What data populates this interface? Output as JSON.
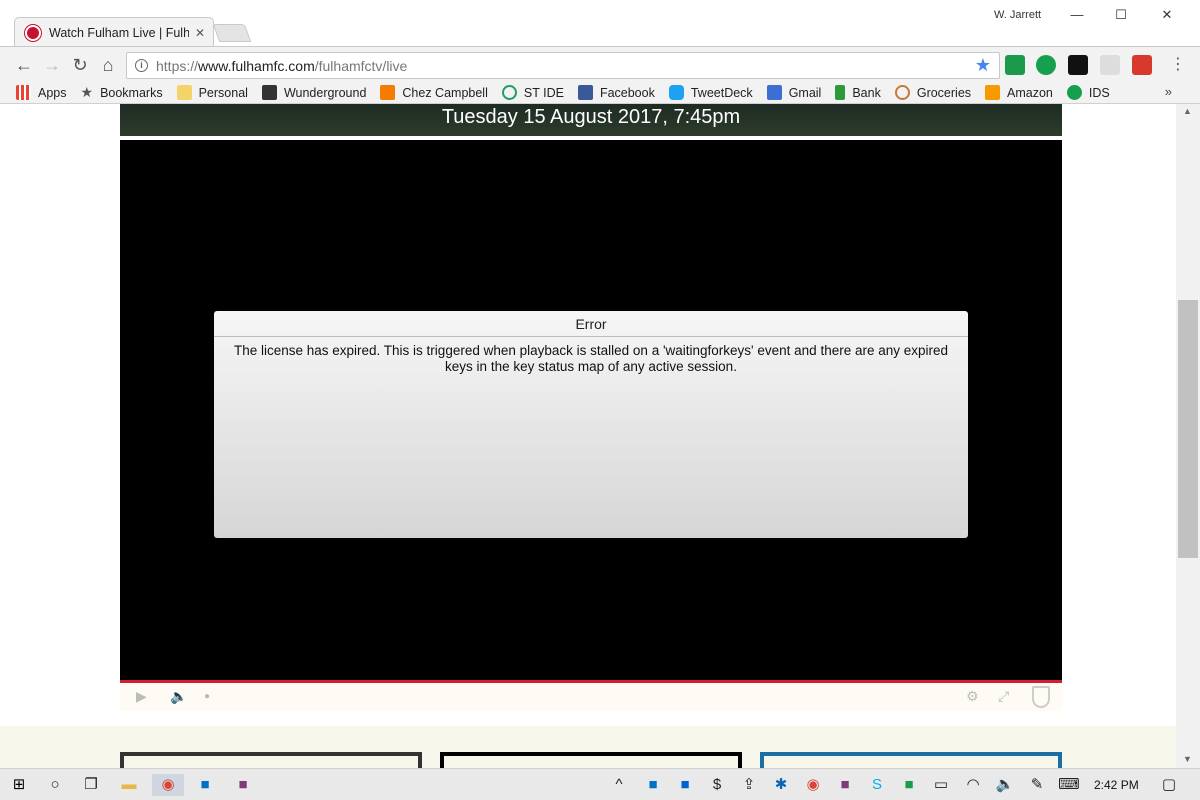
{
  "browser": {
    "tab_title": "Watch Fulham Live | Fulh",
    "profile_name": "W. Jarrett",
    "url_protocol": "https://",
    "url_host": "www.fulhamfc.com",
    "url_path": "/fulhamfctv/live"
  },
  "bookmarks": [
    {
      "label": "Apps",
      "icon": "apps-grid-icon",
      "color": "#4285f4"
    },
    {
      "label": "Bookmarks",
      "icon": "star-icon",
      "color": "#555555"
    },
    {
      "label": "Personal",
      "icon": "folder-icon",
      "color": "#f5d36b"
    },
    {
      "label": "Wunderground",
      "icon": "wunderground-icon",
      "color": "#333333"
    },
    {
      "label": "Chez Campbell",
      "icon": "blogger-icon",
      "color": "#f57c00"
    },
    {
      "label": "ST IDE",
      "icon": "circle-icon",
      "color": "#20a060"
    },
    {
      "label": "Facebook",
      "icon": "facebook-icon",
      "color": "#3b5998"
    },
    {
      "label": "TweetDeck",
      "icon": "tweetdeck-icon",
      "color": "#1da1f2"
    },
    {
      "label": "Gmail",
      "icon": "gmail-icon",
      "color": "#3d6fd3"
    },
    {
      "label": "Bank",
      "icon": "bank-icon",
      "color": "#2d9a3a"
    },
    {
      "label": "Groceries",
      "icon": "groceries-icon",
      "color": "#c47a3a"
    },
    {
      "label": "Amazon",
      "icon": "amazon-icon",
      "color": "#f59b00"
    },
    {
      "label": "IDS",
      "icon": "ids-icon",
      "color": "#16a04d"
    }
  ],
  "page": {
    "banner_date": "Tuesday 15 August 2017, 7:45pm",
    "error_title": "Error",
    "error_message": "The license has expired. This is triggered when playback is stalled on a 'waitingforkeys' event and there are any expired keys in the key status map of any active session."
  },
  "taskbar": {
    "time": "2:42 PM"
  },
  "colors": {
    "player_accent": "#d21e2e",
    "star": "#4285f4"
  }
}
